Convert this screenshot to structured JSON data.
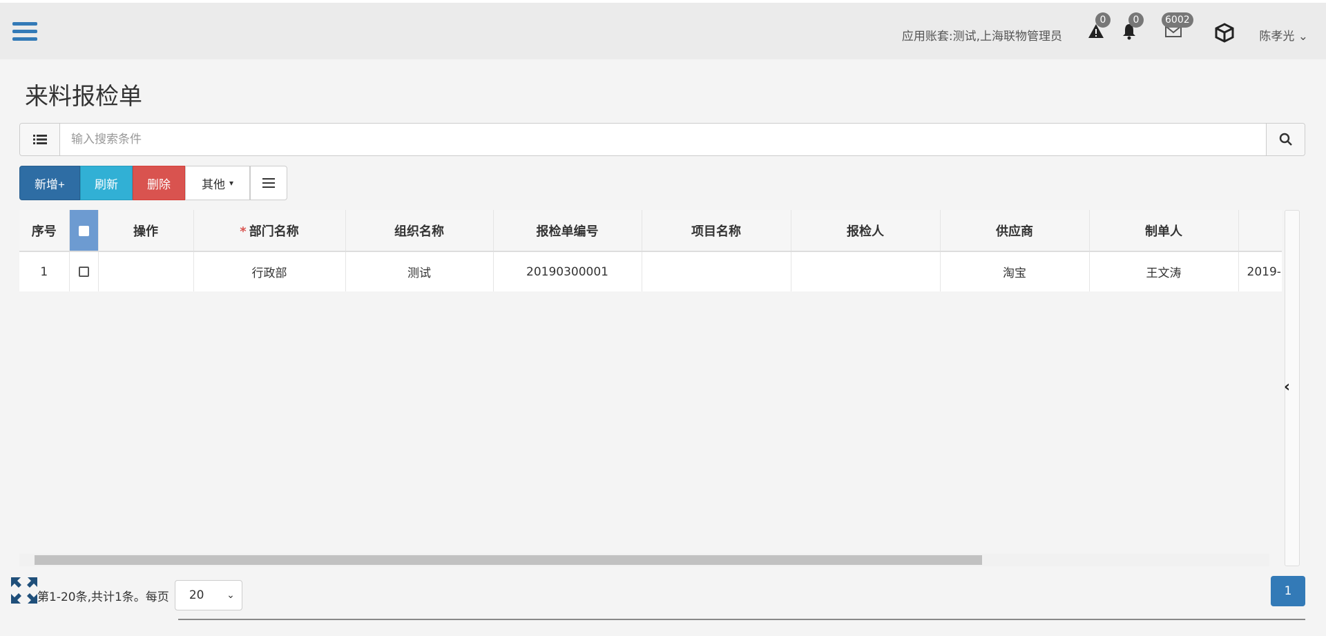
{
  "topbar": {
    "account_text": "应用账套:测试,上海联物管理员",
    "alert_badge": "0",
    "bell_badge": "0",
    "mail_badge": "6002",
    "user_name": "陈孝光"
  },
  "page": {
    "title": "来料报检单"
  },
  "search": {
    "placeholder": "输入搜索条件"
  },
  "toolbar": {
    "new_label": "新增+",
    "refresh_label": "刷新",
    "delete_label": "删除",
    "other_label": "其他"
  },
  "table": {
    "columns": {
      "seq": "序号",
      "action": "操作",
      "dept": "部门名称",
      "org": "组织名称",
      "code": "报检单编号",
      "project": "项目名称",
      "inspector": "报检人",
      "supplier": "供应商",
      "maker": "制单人"
    },
    "rows": [
      {
        "seq": "1",
        "action": "",
        "dept": "行政部",
        "org": "测试",
        "code": "20190300001",
        "project": "",
        "inspector": "",
        "supplier": "淘宝",
        "maker": "王文涛",
        "date": "2019-"
      }
    ]
  },
  "pager": {
    "info": "第1-20条,共计1条。每页",
    "page_size": "20",
    "current_page": "1"
  },
  "icons": {
    "menu": "hamburger-icon",
    "alert": "alert-icon",
    "bell": "bell-icon",
    "mail": "mail-icon",
    "box": "box-icon",
    "search": "search-icon",
    "list": "list-icon",
    "expand": "expand-icon"
  },
  "colors": {
    "primary": "#337ab7",
    "info": "#31b0d5",
    "danger": "#d9534f"
  }
}
